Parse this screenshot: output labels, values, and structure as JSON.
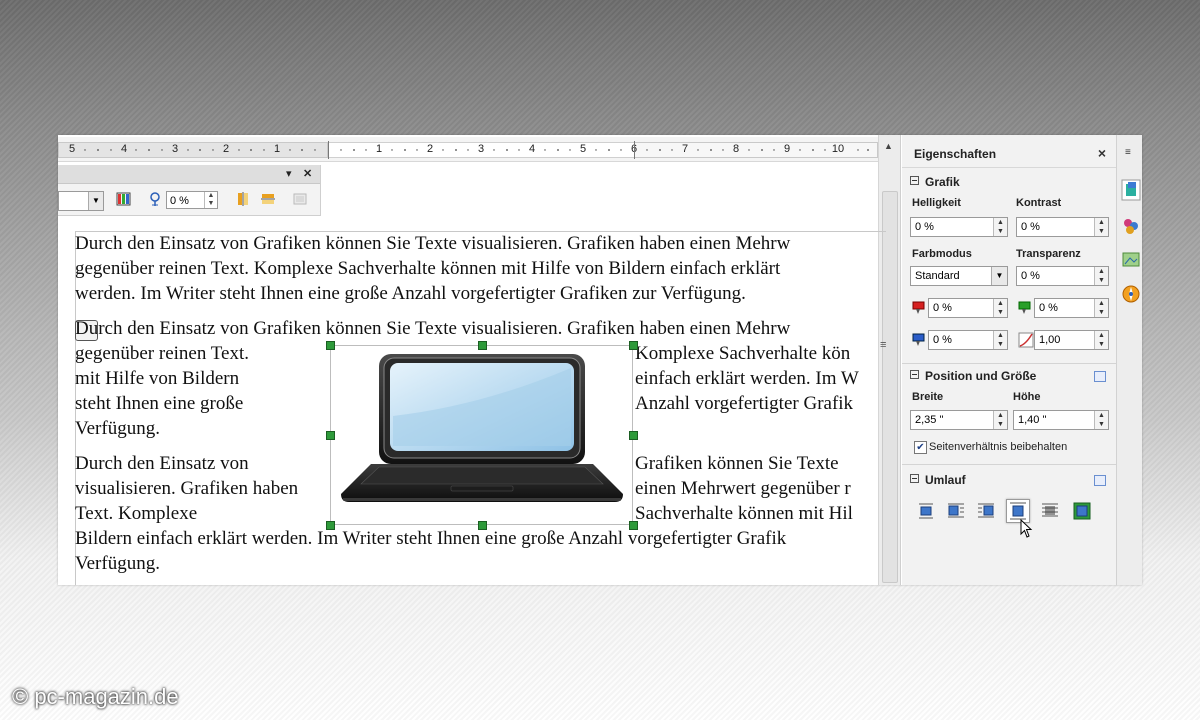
{
  "ruler": {
    "left_numbers": [
      "5",
      "4",
      "3",
      "2",
      "1"
    ],
    "right_numbers": [
      "1",
      "2",
      "3",
      "4",
      "5",
      "6",
      "7",
      "8",
      "9",
      "10"
    ]
  },
  "image_toolbar": {
    "percent_value": "0 %"
  },
  "document": {
    "paragraph1": [
      "Durch den Einsatz von Grafiken können Sie Texte visualisieren. Grafiken haben einen Mehrw",
      "gegenüber reinen Text. Komplexe Sachverhalte können mit Hilfe von Bildern einfach erklärt",
      "werden. Im Writer steht Ihnen eine große Anzahl vorgefertigter Grafiken zur Verfügung."
    ],
    "paragraph2_full": "Durch den Einsatz von Grafiken können Sie Texte visualisieren. Grafiken haben einen Mehrw",
    "paragraph2_left": [
      "gegenüber reinen Text.",
      "mit Hilfe von Bildern",
      "steht Ihnen eine große",
      "Verfügung."
    ],
    "paragraph2_right": [
      "Komplexe Sachverhalte kön",
      "einfach erklärt werden. Im W",
      "Anzahl vorgefertigter Grafik"
    ],
    "paragraph3_left": [
      "Durch den Einsatz von",
      "visualisieren. Grafiken haben",
      "Text. Komplexe"
    ],
    "paragraph3_right": [
      "Grafiken können Sie Texte",
      "einen Mehrwert gegenüber r",
      "Sachverhalte können mit Hil"
    ],
    "paragraph3_full": [
      "Bildern einfach erklärt werden. Im Writer steht Ihnen eine große Anzahl vorgefertigter Grafik",
      "Verfügung."
    ]
  },
  "sidebar": {
    "title": "Eigenschaften",
    "close": "×",
    "grafik": {
      "title": "Grafik",
      "helligkeit_label": "Helligkeit",
      "helligkeit_value": "0 %",
      "kontrast_label": "Kontrast",
      "kontrast_value": "0 %",
      "farbmodus_label": "Farbmodus",
      "farbmodus_value": "Standard",
      "transparenz_label": "Transparenz",
      "transparenz_value": "0 %",
      "red_value": "0 %",
      "green_value": "0 %",
      "blue_value": "0 %",
      "gamma_value": "1,00"
    },
    "position": {
      "title": "Position und Größe",
      "breite_label": "Breite",
      "breite_value": "2,35 \"",
      "hoehe_label": "Höhe",
      "hoehe_value": "1,40 \"",
      "keep_ratio_label": "Seitenverhältnis beibehalten",
      "keep_ratio_checked": true
    },
    "umlauf": {
      "title": "Umlauf"
    }
  },
  "watermark": "© pc-magazin.de"
}
